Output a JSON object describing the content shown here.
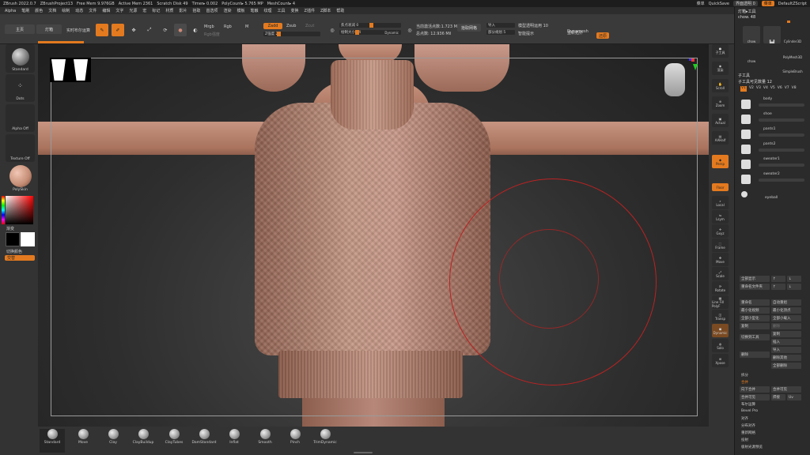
{
  "titlebar": {
    "app": "ZBrush 2022.0.7",
    "project": "ZBrushProject13",
    "free_mem": "Free Mem 9.976GB",
    "active_mem": "Active Mem 2361",
    "scratch_disk": "Scratch Disk 49",
    "timer": "Timer▸ 0.002",
    "polycount": "PolyCount▸ 5.765 MP",
    "meshcount": "MeshCount▸ 4",
    "menus_label": "菜单",
    "quicksave": "QuickSave",
    "transparency": "界面透明 0",
    "menu_toggle": "菜单",
    "script": "DefaultZScript"
  },
  "menubar": {
    "items": [
      "Alpha",
      "笔刷",
      "颜色",
      "文档",
      "绘制",
      "动态",
      "文件",
      "编辑",
      "文字",
      "光源",
      "宏",
      "标记",
      "材质",
      "影片",
      "拾取",
      "首选项",
      "渲染",
      "模板",
      "笔触",
      "纹理",
      "工具",
      "变换",
      "Z插件",
      "Z脚本",
      "帮助"
    ]
  },
  "topshelf": {
    "home": "主页",
    "lightbox": "灯箱",
    "live_boolean": "实时布尔运算",
    "edit": "Edit",
    "draw": "绘制",
    "move": "移动",
    "scale": "缩放",
    "rotate": "旋转",
    "mrgb": "Mrgb",
    "rgb": "Rgb",
    "m": "M",
    "rgb_intensity": "Rgb强度",
    "zadd": "Zadd",
    "zsub": "Zsub",
    "zcut": "Zcut",
    "z_intensity": "Z强度 25",
    "focal_shift": "焦点衰减 0",
    "draw_size": "绘制大小 64",
    "dynamic": "Dynamic",
    "active_points": "当前激活点数:1.723 Mil",
    "total_points": "总点数: 12.936 Mil",
    "spotlight": "拾取网格",
    "import": "导入",
    "split_subtool": "部分规划 5",
    "model_opacity": "模型透明运用 10",
    "smart_hide": "智能提示",
    "dynamesh": "Dynamesh",
    "resolution": "重新拓扑",
    "restore": "还原"
  },
  "leftshelf": {
    "brush": "Standard",
    "stroke": "Dots",
    "alpha": "Alpha Off",
    "texture": "Texture Off",
    "material": "PolySkin",
    "gradient": "渐变",
    "switch_color": "切换颜色",
    "alternate": "交替"
  },
  "brushes": [
    "Standard",
    "Move",
    "Clay",
    "ClayBuildup",
    "ClayTubes",
    "DamStandard",
    "Inflat",
    "Smooth",
    "Pinch",
    "TrimDynamic"
  ],
  "rightshelf": {
    "buttons": [
      "子工具",
      "渲染",
      "Scroll",
      "Zoom",
      "Actual",
      "AAHalf",
      "Persp",
      "Floor",
      "Local",
      "Lsym",
      "Gxyz",
      "Frame",
      "Move",
      "Scale",
      "Rotate",
      "Line Fill PolyF",
      "Transp",
      "Dynamic",
      "Solo",
      "Xpose"
    ]
  },
  "panel": {
    "lightbox_tool": "灯箱▸工具",
    "tool_name": "chow. 48",
    "tools": [
      "chow",
      "Cylinder3D",
      "PolyMesh3D",
      "chow",
      "SimpleBrush"
    ],
    "subtool_header": "子工具",
    "subtool_count": "子工具可见数量 12",
    "tabs": [
      "V1",
      "V2",
      "V3",
      "V4",
      "V5",
      "V6",
      "V7",
      "V8"
    ],
    "subtools": [
      "body",
      "shoe",
      "pants1",
      "pants2",
      "sweater1",
      "sweater2",
      "eyeball"
    ],
    "row1": [
      "全部显示",
      "↑",
      "↓"
    ],
    "row2": [
      "重命名文件夹",
      "↑",
      "↓"
    ],
    "actions": [
      [
        "重命名",
        "自动重组"
      ],
      [
        "最小化视频",
        "最小化顶点"
      ],
      [
        "全部小型化",
        "全部小载入"
      ],
      [
        "复制",
        "删除"
      ],
      [
        "切换到工具",
        "复制"
      ],
      [
        "插入",
        "导入"
      ],
      [
        "删除",
        "删除其他"
      ],
      [
        "",
        "全部删除"
      ]
    ],
    "list": [
      "拆分",
      "合并",
      "向下合并",
      "合并可见",
      "布尔运算",
      "Bevel Pro",
      "对齐",
      "分布对齐",
      "重新网格",
      "投射",
      "极射光源预览",
      "提取"
    ],
    "merge_row": [
      "向下合并",
      "合并可见"
    ],
    "weld_row": [
      "合并可见",
      "焊接",
      "Uv"
    ]
  }
}
